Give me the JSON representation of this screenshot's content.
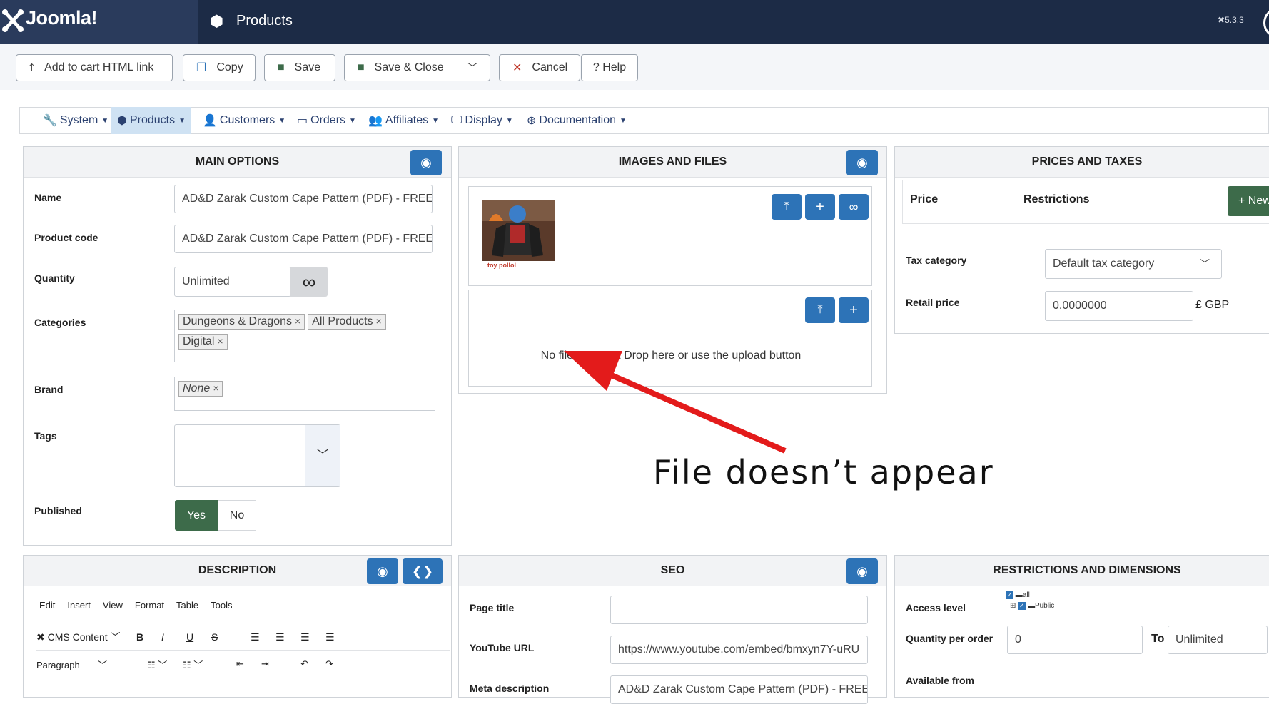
{
  "header": {
    "logo_text": "Joomla!",
    "title": "Products",
    "version": "5.3.3"
  },
  "toolbar": {
    "add_to_cart": "Add to cart HTML link",
    "copy": "Copy",
    "save": "Save",
    "save_close": "Save & Close",
    "cancel": "Cancel",
    "help": "Help"
  },
  "menu": {
    "system": "System",
    "products": "Products",
    "customers": "Customers",
    "orders": "Orders",
    "affiliates": "Affiliates",
    "display": "Display",
    "documentation": "Documentation"
  },
  "main_options": {
    "title": "MAIN OPTIONS",
    "name_label": "Name",
    "name_value": "AD&D Zarak Custom Cape Pattern (PDF) - FREE",
    "code_label": "Product code",
    "code_value": "AD&D Zarak Custom Cape Pattern (PDF) - FREE",
    "quantity_label": "Quantity",
    "quantity_value": "Unlimited",
    "categories_label": "Categories",
    "categories": [
      "Dungeons & Dragons",
      "All Products",
      "Digital"
    ],
    "brand_label": "Brand",
    "brand_value": "None",
    "tags_label": "Tags",
    "published_label": "Published",
    "published_yes": "Yes",
    "published_no": "No"
  },
  "images_files": {
    "title": "IMAGES AND FILES",
    "thumb_caption": "toy pollol",
    "files_message": "No files. Drag & Drop here or use the upload button"
  },
  "prices": {
    "title": "PRICES AND TAXES",
    "col_price": "Price",
    "col_restrictions": "Restrictions",
    "new_button": "New",
    "tax_label": "Tax category",
    "tax_value": "Default tax category",
    "retail_label": "Retail price",
    "retail_value": "0.0000000",
    "currency": "£ GBP"
  },
  "annotation": "File doesn’t appear",
  "description": {
    "title": "DESCRIPTION",
    "menu_items": [
      "Edit",
      "Insert",
      "View",
      "Format",
      "Table",
      "Tools"
    ],
    "cms_content": "CMS Content",
    "paragraph": "Paragraph"
  },
  "seo": {
    "title": "SEO",
    "page_title_label": "Page title",
    "page_title_value": "",
    "youtube_label": "YouTube URL",
    "youtube_value": "https://www.youtube.com/embed/bmxyn7Y-uRU",
    "meta_label": "Meta description",
    "meta_value": "AD&D Zarak Custom Cape Pattern (PDF) - FREE"
  },
  "restrictions": {
    "title": "RESTRICTIONS AND DIMENSIONS",
    "access_label": "Access level",
    "access_all": "all",
    "access_public": "Public",
    "qty_order_label": "Quantity per order",
    "qty_from": "0",
    "qty_to_label": "To",
    "qty_to": "Unlimited",
    "available_label": "Available from"
  },
  "colors": {
    "header_bg": "#1c2b46",
    "accent_blue": "#2d73b7",
    "green": "#3d6b4a",
    "arrow_red": "#e31b1b"
  }
}
